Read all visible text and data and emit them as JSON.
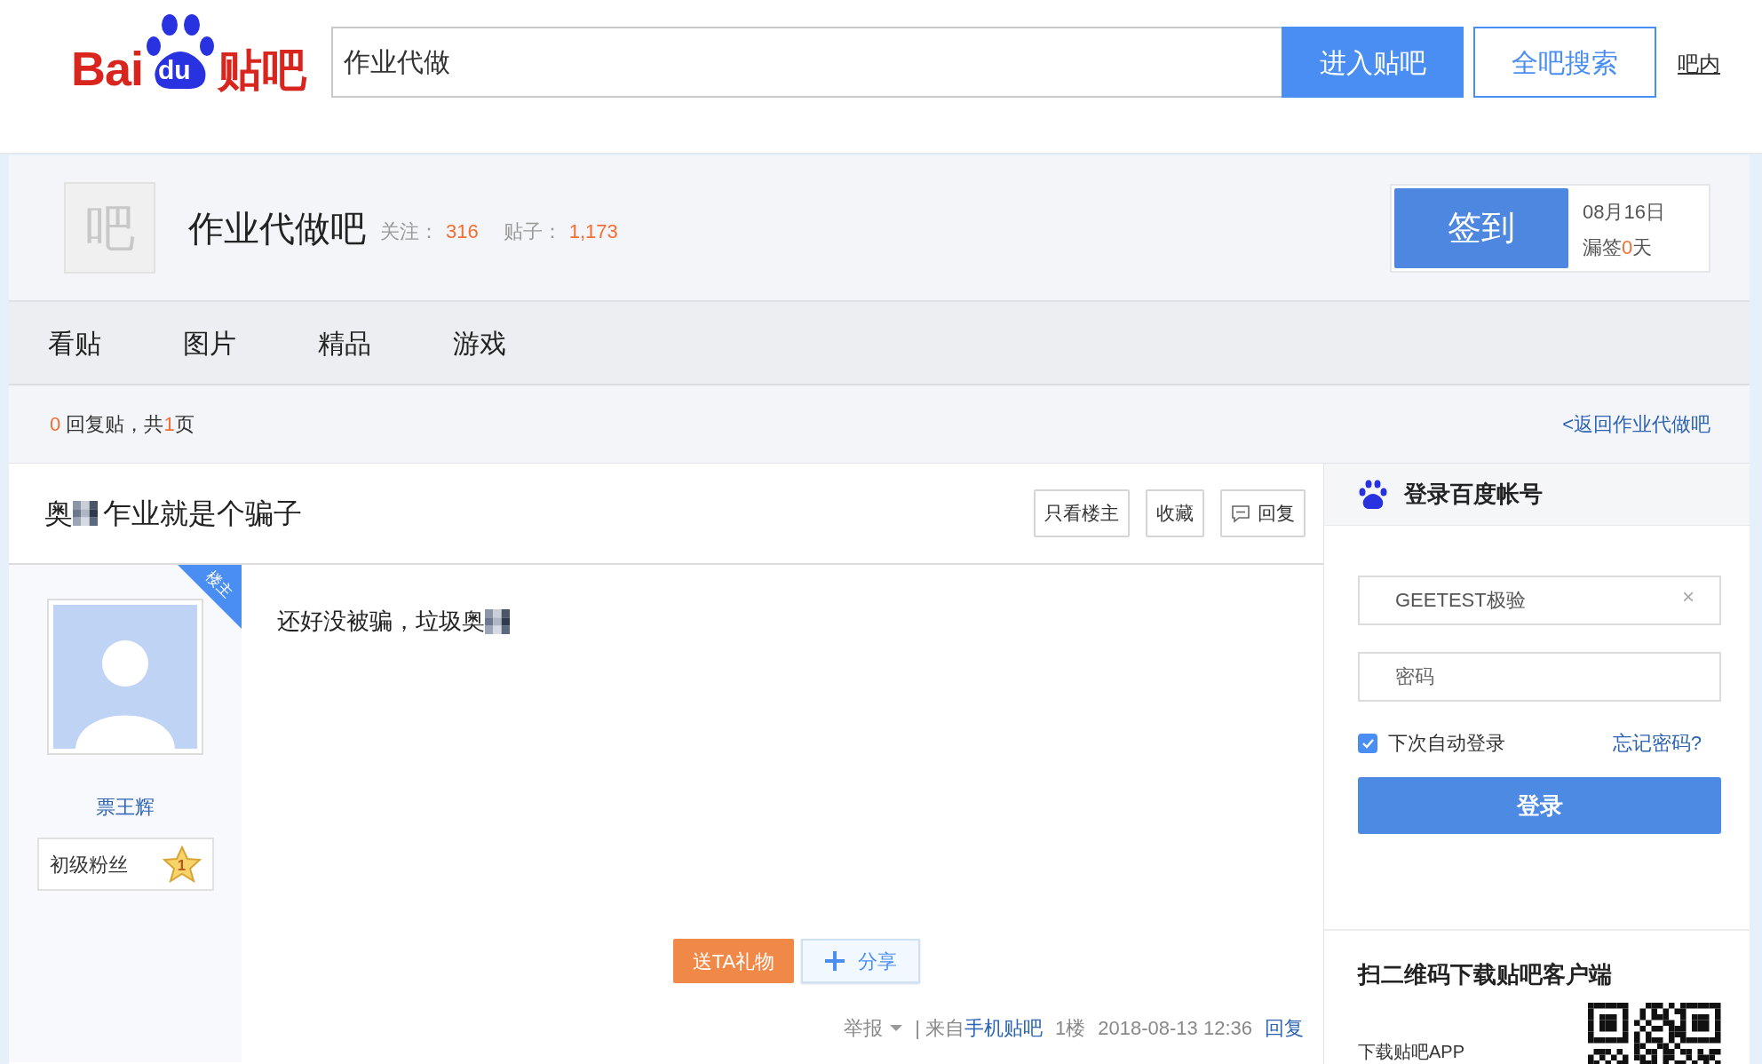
{
  "header": {
    "logo": {
      "latin": "Bai",
      "paw": "du",
      "cjk": "贴吧"
    },
    "search": {
      "value": "作业代做"
    },
    "buttons": [
      {
        "label": "进入贴吧",
        "kind": "primary"
      },
      {
        "label": "全吧搜索",
        "kind": "outline"
      }
    ],
    "link": "吧内"
  },
  "forum": {
    "icon_char": "吧",
    "name": "作业代做吧",
    "stats": [
      {
        "label": "关注：",
        "value": "316"
      },
      {
        "label": "贴子：",
        "value": "1,173"
      }
    ],
    "sign": {
      "button": "签到",
      "date": "08月16日",
      "missed_prefix": "漏签",
      "missed_count": "0",
      "missed_suffix": "天"
    }
  },
  "tabs": [
    {
      "label": "看贴",
      "selected": false
    },
    {
      "label": "图片",
      "selected": false
    },
    {
      "label": "精品",
      "selected": false
    },
    {
      "label": "游戏",
      "selected": false
    }
  ],
  "pager": {
    "reply_count": "0",
    "text_mid": "回复贴，共",
    "pages": "1",
    "text_end": "页",
    "back_link": "<返回作业代做吧"
  },
  "thread": {
    "title_start": "奥",
    "title_end": "乍业就是个骗子",
    "actions": [
      {
        "label": "只看楼主",
        "kind": "plain"
      },
      {
        "label": "收藏",
        "kind": "plain"
      },
      {
        "label": "回复",
        "kind": "reply"
      }
    ]
  },
  "post": {
    "author": {
      "name": "票王辉",
      "badge": "初级粉丝",
      "level": "1",
      "ribbon": "楼主"
    },
    "content": "还好没被骗，垃圾奥",
    "gift": "送TA礼物",
    "share": "分享",
    "footer": {
      "report": "举报",
      "source_prefix": "| 来自",
      "source_link": "手机贴吧",
      "floor": "1楼",
      "time": "2018-08-13 12:36",
      "reply": "回复"
    }
  },
  "sidebar": {
    "title": "登录百度帐号",
    "username": {
      "value": "GEETEST极验",
      "clear": "×"
    },
    "password": {
      "placeholder": "密码"
    },
    "remember": {
      "label": "下次自动登录",
      "checked": true
    },
    "forgot": "忘记密码?",
    "login": "登录",
    "qr": {
      "title": "扫二维码下载贴吧客户端",
      "caption": "下载贴吧APP"
    }
  }
}
